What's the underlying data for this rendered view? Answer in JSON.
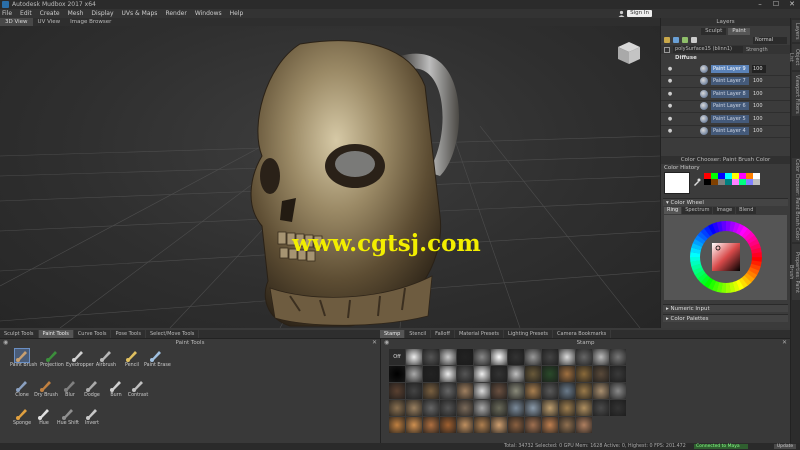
{
  "window": {
    "title": "Autodesk Mudbox 2017 x64",
    "min": "–",
    "max": "☐",
    "close": "✕"
  },
  "menu": [
    "File",
    "Edit",
    "Create",
    "Mesh",
    "Display",
    "UVs & Maps",
    "Render",
    "Windows",
    "Help"
  ],
  "signin": "Sign In",
  "view_tabs": [
    "3D View",
    "UV View",
    "Image Browser"
  ],
  "watermark": "www.cgtsj.com",
  "layers": {
    "title": "Layers",
    "tabs": [
      "Sculpt",
      "Paint"
    ],
    "blend_mode": "Normal",
    "object": "polySurface15 (blinn1)",
    "strength_label": "Strength",
    "channel": "Diffuse",
    "items": [
      {
        "name": "Paint Layer 9",
        "opacity": "100",
        "selected": true
      },
      {
        "name": "Paint Layer 7",
        "opacity": "100"
      },
      {
        "name": "Paint Layer 8",
        "opacity": "100"
      },
      {
        "name": "Paint Layer 6",
        "opacity": "100"
      },
      {
        "name": "Paint Layer 5",
        "opacity": "100"
      },
      {
        "name": "Paint Layer 4",
        "opacity": "100"
      }
    ]
  },
  "color_chooser": {
    "title": "Color Chooser: Paint Brush Color",
    "history_label": "Color History",
    "current_color": "#ffffff",
    "swatches": [
      "#ff0000",
      "#00ff00",
      "#0000ff",
      "#00ffff",
      "#ffff00",
      "#ff00ff",
      "#ff8000",
      "#ffffff",
      "#000000",
      "#804000",
      "#808080",
      "#008080",
      "#ff80ff",
      "#00ff80",
      "#8080ff",
      "#c0c0c0"
    ],
    "wheel_label": "Color Wheel",
    "wheel_tabs": [
      "Ring",
      "Spectrum",
      "Image",
      "Blend"
    ],
    "numeric_label": "Numeric Input",
    "palettes_label": "Color Palettes"
  },
  "right_strip": [
    "Layers",
    "Object List",
    "Viewport Filters",
    "Color Chooser: Paint Brush Color",
    "Properties: Paint Brush"
  ],
  "bottom_tabs": [
    "Sculpt Tools",
    "Paint Tools",
    "Curve Tools",
    "Pose Tools",
    "Select/Move Tools"
  ],
  "right_tabs": [
    "Stamp",
    "Stencil",
    "Falloff",
    "Material Presets",
    "Lighting Presets",
    "Camera Bookmarks"
  ],
  "paint_tools": {
    "title": "Paint Tools",
    "items": [
      "Paint Brush",
      "Projection",
      "Eyedropper",
      "Airbrush",
      "Pencil",
      "Paint Erase",
      "Clone",
      "Dry Brush",
      "Blur",
      "Dodge",
      "Burn",
      "Contrast",
      "Sponge",
      "Hue",
      "Hue Shift",
      "Invert"
    ]
  },
  "stamps": {
    "title": "Stamp",
    "off_label": "Off"
  },
  "status": {
    "text": "Total: 34732  Selected: 0  GPU Mem: 1628  Active: 0, Highest: 0  FPS: 201.472",
    "connection": "Connected to Maya",
    "update": "Update"
  },
  "colors": {
    "accent": "#5a82b8",
    "panel": "#3b3b3b",
    "background": "#2f2f2f",
    "watermark": "#f2ee00"
  }
}
